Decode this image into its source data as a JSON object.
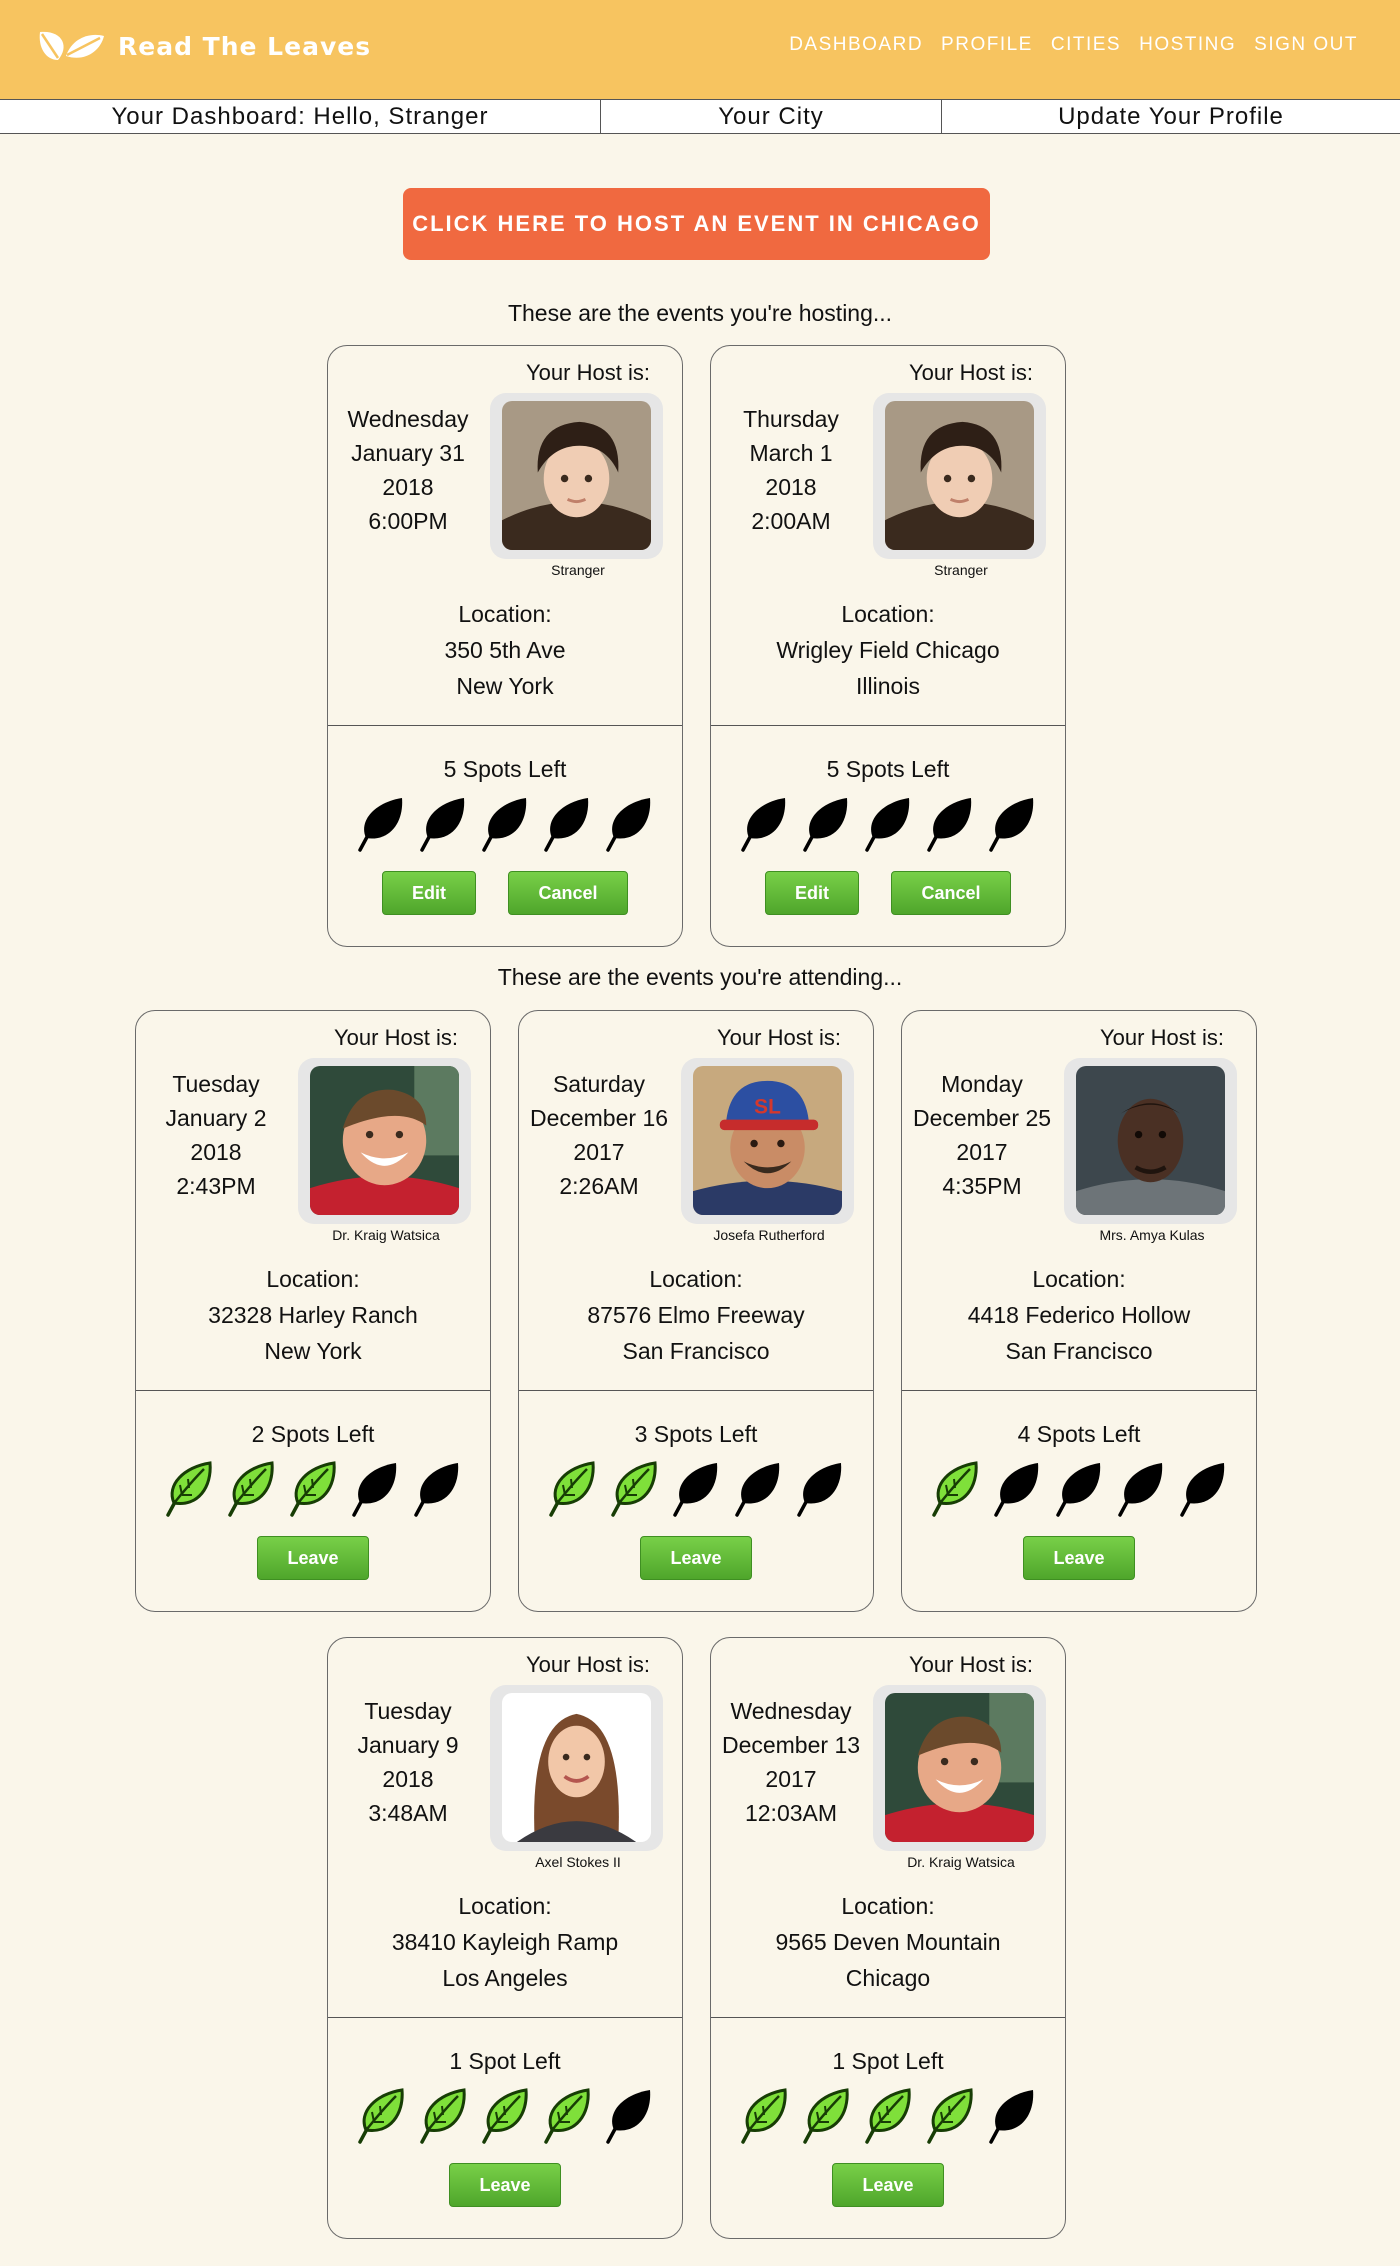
{
  "brand": {
    "name": "Read The Leaves"
  },
  "nav": [
    "DASHBOARD",
    "PROFILE",
    "CITIES",
    "HOSTING",
    "SIGN OUT"
  ],
  "subnav": [
    "Your Dashboard: Hello, Stranger",
    "Your City",
    "Update Your Profile"
  ],
  "host_button": "CLICK HERE TO HOST AN EVENT IN CHICAGO",
  "sections": {
    "hosting": "These are the events you're hosting...",
    "attending": "These are the events you're attending..."
  },
  "labels": {
    "your_host": "Your Host is:",
    "location": "Location:",
    "edit": "Edit",
    "cancel": "Cancel",
    "leave": "Leave"
  },
  "colors": {
    "header": "#f7c460",
    "accent": "#f06940",
    "button_green": "#5cb832",
    "leaf_filled": "#7fe03a",
    "leaf_empty": "#000000",
    "page_bg": "#faf6ea"
  },
  "hosting": [
    {
      "day": "Wednesday",
      "date": "January 31",
      "year": "2018",
      "time": "6:00PM",
      "host": "Stranger",
      "avatar": "boy-avatar",
      "loc1": "350 5th Ave",
      "loc2": "New York",
      "spots": "5 Spots Left",
      "filled": 0,
      "total": 5
    },
    {
      "day": "Thursday",
      "date": "March 1",
      "year": "2018",
      "time": "2:00AM",
      "host": "Stranger",
      "avatar": "boy-avatar",
      "loc1": "Wrigley Field Chicago",
      "loc2": "Illinois",
      "spots": "5 Spots Left",
      "filled": 0,
      "total": 5
    }
  ],
  "attending": [
    {
      "day": "Tuesday",
      "date": "January 2",
      "year": "2018",
      "time": "2:43PM",
      "host": "Dr. Kraig Watsica",
      "avatar": "smiling-man-avatar",
      "loc1": "32328 Harley Ranch",
      "loc2": "New York",
      "spots": "2 Spots Left",
      "filled": 3,
      "total": 5
    },
    {
      "day": "Saturday",
      "date": "December 16",
      "year": "2017",
      "time": "2:26AM",
      "host": "Josefa Rutherford",
      "avatar": "cap-man-avatar",
      "loc1": "87576 Elmo Freeway",
      "loc2": "San Francisco",
      "spots": "3 Spots Left",
      "filled": 2,
      "total": 5
    },
    {
      "day": "Monday",
      "date": "December 25",
      "year": "2017",
      "time": "4:35PM",
      "host": "Mrs. Amya Kulas",
      "avatar": "dark-man-avatar",
      "loc1": "4418 Federico Hollow",
      "loc2": "San Francisco",
      "spots": "4 Spots Left",
      "filled": 1,
      "total": 5
    },
    {
      "day": "Tuesday",
      "date": "January 9",
      "year": "2018",
      "time": "3:48AM",
      "host": "Axel Stokes II",
      "avatar": "woman-avatar",
      "loc1": "38410 Kayleigh Ramp",
      "loc2": "Los Angeles",
      "spots": "1 Spot Left",
      "filled": 4,
      "total": 5
    },
    {
      "day": "Wednesday",
      "date": "December 13",
      "year": "2017",
      "time": "12:03AM",
      "host": "Dr. Kraig Watsica",
      "avatar": "smiling-man-avatar",
      "loc1": "9565 Deven Mountain",
      "loc2": "Chicago",
      "spots": "1 Spot Left",
      "filled": 4,
      "total": 5
    }
  ]
}
